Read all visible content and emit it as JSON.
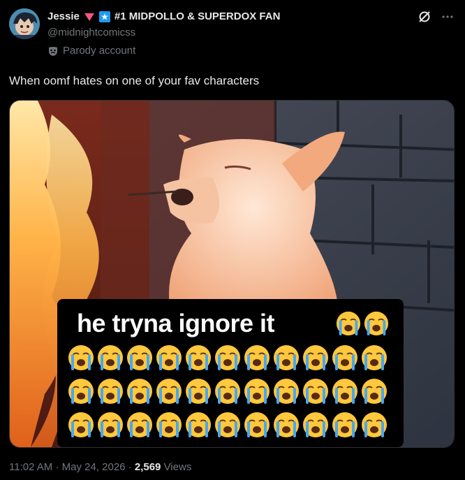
{
  "author": {
    "name": "Jessie",
    "bio_tag": "#1 MIDPOLLO & SUPERDOX FAN",
    "handle": "@midnightcomicss",
    "parody_label": "Parody account"
  },
  "tweet": {
    "text": "When oomf hates on one of your fav characters",
    "caption": "he tryna ignore it",
    "time": "11:02 AM",
    "separator": "·",
    "date": "May 24, 2026",
    "views_count": "2,569",
    "views_label": "Views"
  },
  "icons": {
    "grok": "grok-icon",
    "more": "more-icon",
    "emoji": "loudly-crying-face-emoji"
  },
  "colors": {
    "heart": "#f4587a",
    "badge": "#1d9bf0",
    "muted": "#71767b",
    "text": "#e7e9ea"
  }
}
